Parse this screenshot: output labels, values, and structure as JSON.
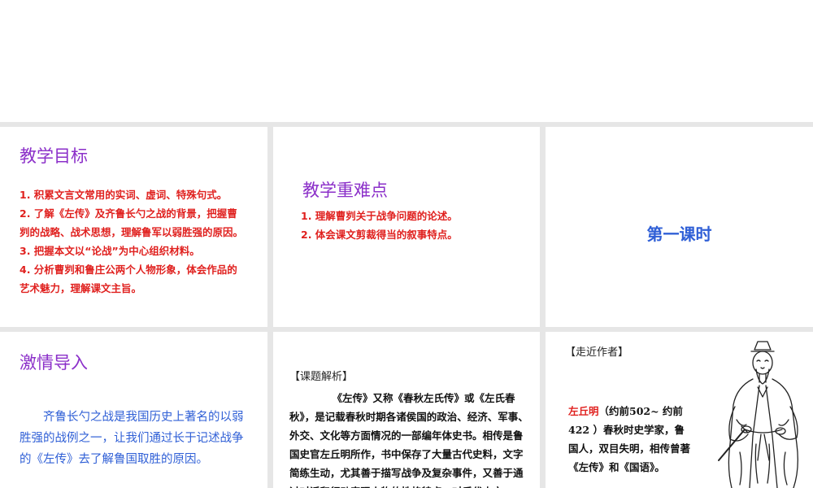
{
  "slides": {
    "goals": {
      "title": "教学目标",
      "items": [
        "1. 积累文言文常用的实词、虚词、特殊句式。",
        "2. 了解《左传》及齐鲁长勺之战的背景，把握曹",
        "刿的战略、战术思想，理解鲁军以弱胜强的原因。",
        "3. 把握本文以“论战”为中心组织材料。",
        "4. 分析曹刿和鲁庄公两个人物形象，体会作品的",
        "艺术魅力，理解课文主旨。"
      ]
    },
    "key_points": {
      "title": "教学重难点",
      "items": [
        "1. 理解曹刿关于战争问题的论述。",
        "2. 体会课文剪裁得当的叙事特点。"
      ]
    },
    "lesson": {
      "label": "第一课时"
    },
    "intro": {
      "title": "激情导入",
      "text": "齐鲁长勺之战是我国历史上著名的以弱胜强的战例之一，让我们通过长于记述战争的《左传》去了解鲁国取胜的原因。"
    },
    "topic": {
      "label": "【课题解析】",
      "text": "《左传》又称《春秋左氏传》或《左氏春秋》，是记载春秋时期各诸侯国的政治、经济、军事、外交、文化等方面情况的一部编年体史书。相传是鲁国史官左丘明所作，书中保存了大量古代史料，文字简练生动，尤其善于描写战争及复杂事件，又善于通过对话和行动表现人物的性格特点，对后代史文"
    },
    "author": {
      "label": "【走近作者】",
      "name": "左丘明",
      "text": "（约前502~ 约前 422 ）春秋时史学家，鲁国人，双目失明，相传曾著《左传》和《国语》。"
    }
  },
  "colors": {
    "title_purple": "#8b2fc9",
    "red_text": "#e0211f",
    "blue_text": "#2f5fd6"
  }
}
